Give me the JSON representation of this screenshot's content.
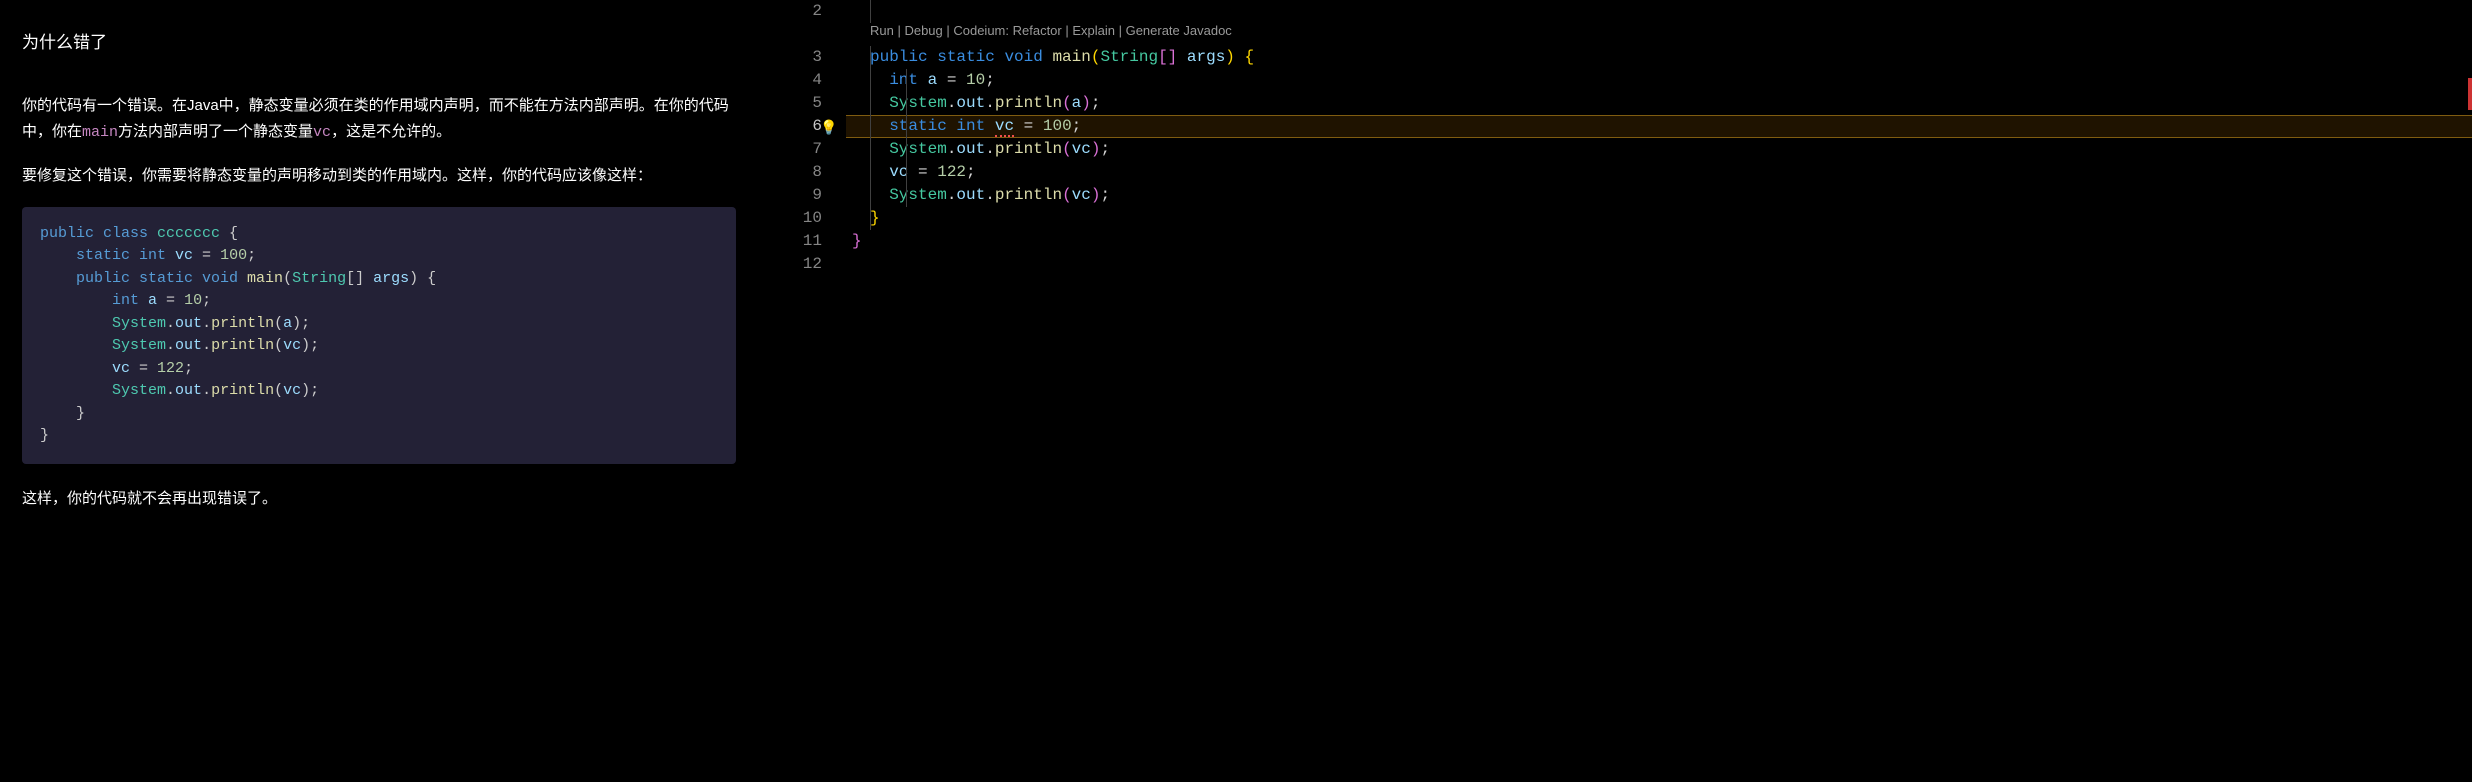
{
  "chat": {
    "title": "为什么错了",
    "para1_a": "你的代码有一个错误。在Java中，静态变量必须在类的作用域内声明，而不能在方法内部声明。在你的代码中，你在",
    "para1_code1": "main",
    "para1_b": "方法内部声明了一个静态变量",
    "para1_code2": "vc",
    "para1_c": "，这是不允许的。",
    "para2": "要修复这个错误，你需要将静态变量的声明移动到类的作用域内。这样，你的代码应该像这样：",
    "para3": "这样，你的代码就不会再出现错误了。",
    "code": {
      "l1": {
        "a": "public class ",
        "b": "ccccccc",
        "c": " {"
      },
      "l2": {
        "a": "    static int ",
        "b": "vc",
        "c": " = ",
        "d": "100",
        "e": ";"
      },
      "l3": "",
      "l4": {
        "a": "    public static void ",
        "b": "main",
        "c": "(",
        "d": "String",
        "e": "[] ",
        "f": "args",
        "g": ") {"
      },
      "l5": {
        "a": "        int ",
        "b": "a",
        "c": " = ",
        "d": "10",
        "e": ";"
      },
      "l6": {
        "a": "        ",
        "b": "System",
        "c": ".",
        "d": "out",
        "e": ".",
        "f": "println",
        "g": "(",
        "h": "a",
        "i": ");"
      },
      "l7": {
        "a": "        ",
        "b": "System",
        "c": ".",
        "d": "out",
        "e": ".",
        "f": "println",
        "g": "(",
        "h": "vc",
        "i": ");"
      },
      "l8": {
        "a": "        ",
        "b": "vc",
        "c": " = ",
        "d": "122",
        "e": ";"
      },
      "l9": {
        "a": "        ",
        "b": "System",
        "c": ".",
        "d": "out",
        "e": ".",
        "f": "println",
        "g": "(",
        "h": "vc",
        "i": ");"
      },
      "l10": "    }",
      "l11": "}"
    }
  },
  "editor": {
    "codelens": "Run | Debug | Codeium: Refactor | Explain | Generate Javadoc",
    "line_numbers": [
      "2",
      "3",
      "4",
      "5",
      "6",
      "7",
      "8",
      "9",
      "10",
      "11",
      "12"
    ],
    "active_line": "6",
    "lines": {
      "l3": {
        "a": "public",
        "sp1": " ",
        "b": "static",
        "sp2": " ",
        "c": "void",
        "sp3": " ",
        "d": "main",
        "e": "(",
        "f": "String",
        "g": "[]",
        "sp4": " ",
        "h": "args",
        "i": ")",
        "sp5": " ",
        "j": "{"
      },
      "l4": {
        "ind": "  ",
        "a": "int",
        "sp": " ",
        "b": "a",
        "c": " = ",
        "d": "10",
        "e": ";"
      },
      "l5": {
        "ind": "  ",
        "a": "System",
        "b": ".",
        "c": "out",
        "d": ".",
        "e": "println",
        "f": "(",
        "g": "a",
        "h": ")",
        "i": ";"
      },
      "l6": {
        "ind": "  ",
        "a": "static",
        "sp1": " ",
        "b": "int",
        "sp2": " ",
        "c": "vc",
        "d": " = ",
        "e": "100",
        "f": ";"
      },
      "l7": {
        "ind": "  ",
        "a": "System",
        "b": ".",
        "c": "out",
        "d": ".",
        "e": "println",
        "f": "(",
        "g": "vc",
        "h": ")",
        "i": ";"
      },
      "l8": {
        "ind": "  ",
        "a": "vc",
        "b": " = ",
        "c": "122",
        "d": ";"
      },
      "l9": {
        "ind": "  ",
        "a": "System",
        "b": ".",
        "c": "out",
        "d": ".",
        "e": "println",
        "f": "(",
        "g": "vc",
        "h": ")",
        "i": ";"
      },
      "l10": {
        "a": "}"
      },
      "l11": {
        "a": "}"
      }
    }
  }
}
